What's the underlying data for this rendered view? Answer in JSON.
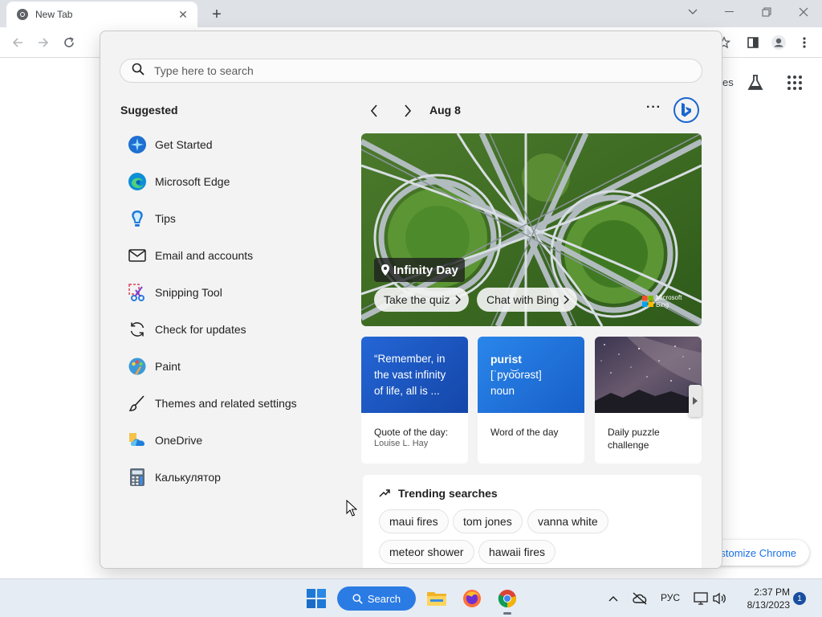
{
  "browser": {
    "tab_title": "New Tab",
    "ntp_fragment": "es",
    "customize_label": "stomize Chrome"
  },
  "flyout": {
    "search_placeholder": "Type here to search",
    "suggested_heading": "Suggested",
    "suggested": [
      {
        "label": "Get Started",
        "icon": "get-started-icon"
      },
      {
        "label": "Microsoft Edge",
        "icon": "edge-icon"
      },
      {
        "label": "Tips",
        "icon": "tips-icon"
      },
      {
        "label": "Email and accounts",
        "icon": "mail-icon"
      },
      {
        "label": "Snipping Tool",
        "icon": "snipping-tool-icon"
      },
      {
        "label": "Check for updates",
        "icon": "refresh-icon"
      },
      {
        "label": "Paint",
        "icon": "paint-icon"
      },
      {
        "label": "Themes and related settings",
        "icon": "brush-icon"
      },
      {
        "label": "OneDrive",
        "icon": "onedrive-icon"
      },
      {
        "label": "Калькулятор",
        "icon": "calculator-icon"
      }
    ],
    "date": "Aug 8",
    "more": "···",
    "hero": {
      "title": "Infinity Day",
      "quiz_label": "Take the quiz",
      "chat_label": "Chat with Bing",
      "brand_line1": "Microsoft",
      "brand_line2": "Bing"
    },
    "cards": {
      "quote_text": "“Remember, in the vast infinity of life, all is ...",
      "quote_caption": "Quote of the day:",
      "quote_author": "Louise L. Hay",
      "word": "purist",
      "word_phonetic": "[ˈpyo͝orəst]",
      "word_pos": "noun",
      "word_caption": "Word of the day",
      "puzzle_caption": "Daily puzzle challenge"
    },
    "trending": {
      "heading": "Trending searches",
      "chips": [
        "maui fires",
        "tom jones",
        "vanna white",
        "meteor shower",
        "hawaii fires"
      ]
    }
  },
  "taskbar": {
    "search_label": "Search",
    "language": "РУС",
    "time": "2:37 PM",
    "date": "8/13/2023",
    "notification_count": "1"
  },
  "colors": {
    "accent": "#2a7be4",
    "flyout_bg": "#f3f3f3",
    "quote_card": "#1f5bc9",
    "word_card": "#1e74db"
  }
}
